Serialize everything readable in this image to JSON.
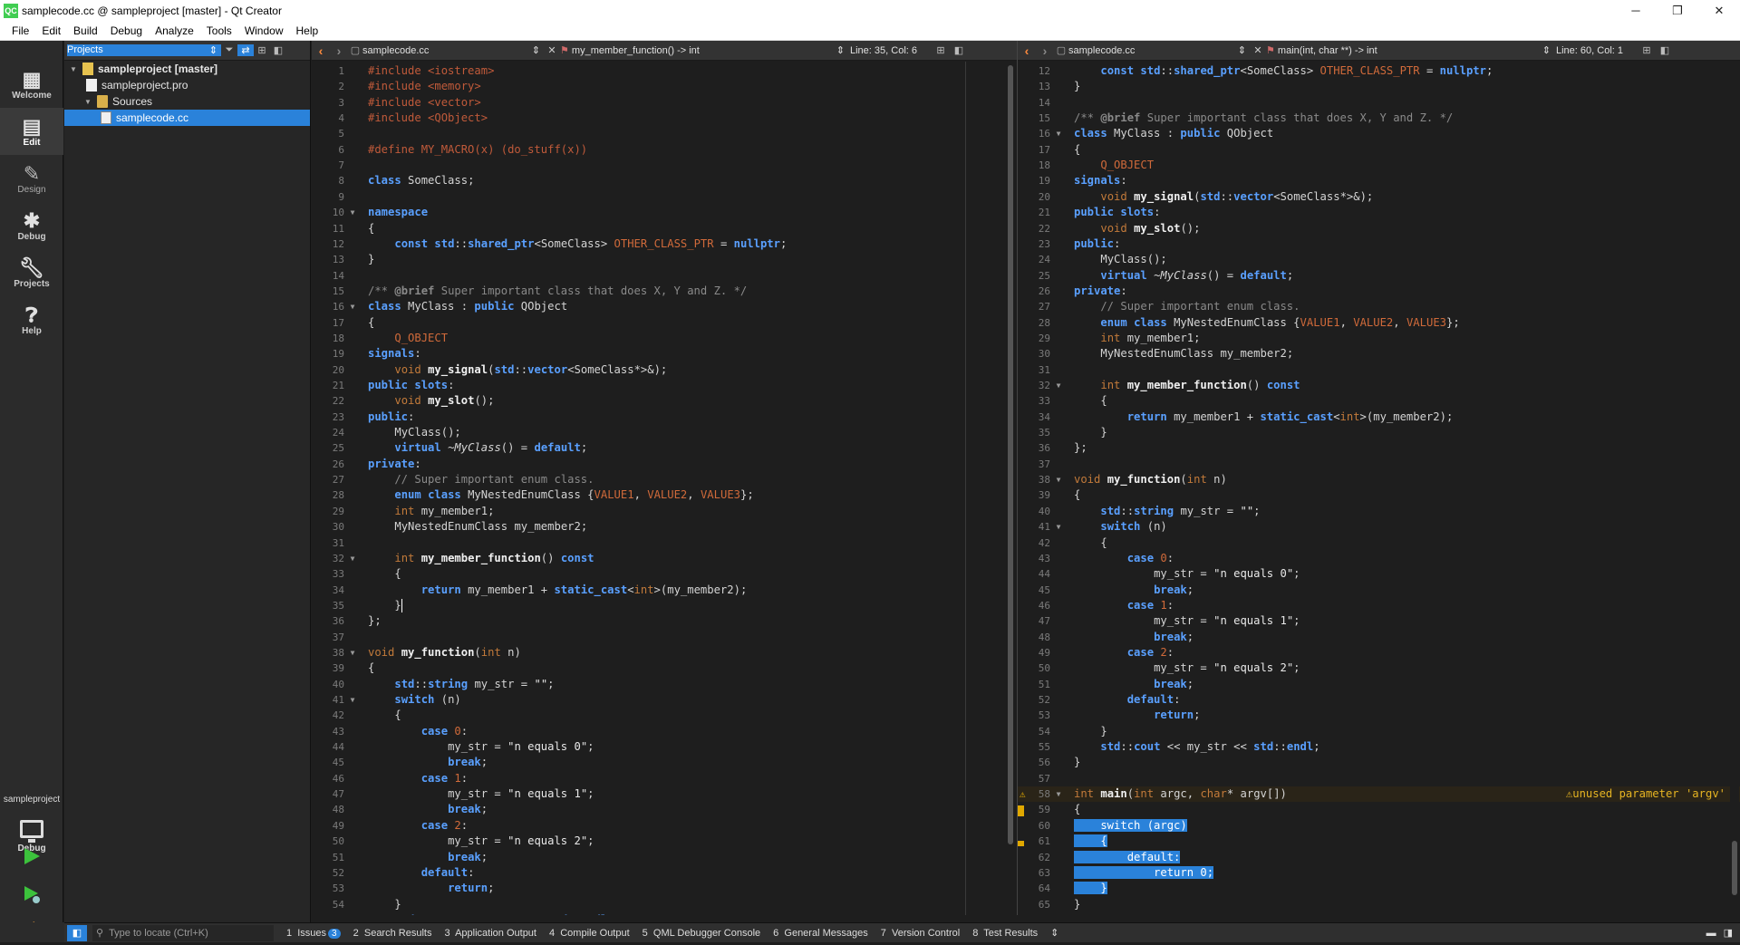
{
  "window": {
    "title": "samplecode.cc @ sampleproject [master] - Qt Creator",
    "app_icon_text": "QC",
    "minimize": "─",
    "maximize": "❐",
    "close": "✕"
  },
  "menubar": [
    "File",
    "Edit",
    "Build",
    "Debug",
    "Analyze",
    "Tools",
    "Window",
    "Help"
  ],
  "modes": [
    {
      "label": "Welcome",
      "icon": "grid-icon"
    },
    {
      "label": "Edit",
      "icon": "edit-icon",
      "active": true
    },
    {
      "label": "Design",
      "icon": "pencil-icon"
    },
    {
      "label": "Debug",
      "icon": "bug-icon"
    },
    {
      "label": "Projects",
      "icon": "wrench-icon"
    },
    {
      "label": "Help",
      "icon": "help-icon"
    }
  ],
  "kit": {
    "project": "sampleproject",
    "config": "Debug"
  },
  "projects_pane": {
    "selector": "Projects",
    "tree": [
      {
        "label": "sampleproject [master]",
        "type": "project",
        "depth": 0,
        "expanded": true
      },
      {
        "label": "sampleproject.pro",
        "type": "pro",
        "depth": 1
      },
      {
        "label": "Sources",
        "type": "folder",
        "depth": 1,
        "expanded": true
      },
      {
        "label": "samplecode.cc",
        "type": "cc",
        "depth": 2,
        "selected": true
      }
    ]
  },
  "editor_left": {
    "file": "samplecode.cc",
    "function": "my_member_function() -> int",
    "position": "Line: 35, Col: 6"
  },
  "editor_right": {
    "file": "samplecode.cc",
    "function": "main(int, char **) -> int",
    "position": "Line: 60, Col: 1",
    "warning": "unused parameter 'argv'"
  },
  "code_lines": {
    "1": "#include <iostream>",
    "2": "#include <memory>",
    "3": "#include <vector>",
    "4": "#include <QObject>",
    "5": "",
    "6": "#define MY_MACRO(x) (do_stuff(x))",
    "7": "",
    "8": "class SomeClass;",
    "9": "",
    "10": "namespace",
    "11": "{",
    "12": "    const std::shared_ptr<SomeClass> OTHER_CLASS_PTR = nullptr;",
    "13": "}",
    "14": "",
    "15": "/** @brief Super important class that does X, Y and Z. */",
    "16": "class MyClass : public QObject",
    "17": "{",
    "18": "    Q_OBJECT",
    "19": "signals:",
    "20": "    void my_signal(std::vector<SomeClass*>&);",
    "21": "public slots:",
    "22": "    void my_slot();",
    "23": "public:",
    "24": "    MyClass();",
    "25": "    virtual ~MyClass() = default;",
    "26": "private:",
    "27": "    // Super important enum class.",
    "28": "    enum class MyNestedEnumClass {VALUE1, VALUE2, VALUE3};",
    "29": "    int my_member1;",
    "30": "    MyNestedEnumClass my_member2;",
    "31": "",
    "32": "    int my_member_function() const",
    "33": "    {",
    "34": "        return my_member1 + static_cast<int>(my_member2);",
    "35": "    }",
    "36": "};",
    "37": "",
    "38": "void my_function(int n)",
    "39": "{",
    "40": "    std::string my_str = \"\";",
    "41": "    switch (n)",
    "42": "    {",
    "43": "        case 0:",
    "44": "            my_str = \"n equals 0\";",
    "45": "            break;",
    "46": "        case 1:",
    "47": "            my_str = \"n equals 1\";",
    "48": "            break;",
    "49": "        case 2:",
    "50": "            my_str = \"n equals 2\";",
    "51": "            break;",
    "52": "        default:",
    "53": "            return;",
    "54": "    }",
    "55": "    std::cout << my_str << std::endl;",
    "56": "}",
    "57": "",
    "58": "int main(int argc, char* argv[])",
    "59": "{",
    "60": "    switch (argc)",
    "61": "    {",
    "62": "        default:",
    "63": "            return 0;",
    "64": "    }",
    "65": "}",
    "66": ""
  },
  "statusbar": {
    "locator_placeholder": "Type to locate (Ctrl+K)",
    "tabs": [
      {
        "num": "1",
        "label": "Issues",
        "badge": "3"
      },
      {
        "num": "2",
        "label": "Search Results"
      },
      {
        "num": "3",
        "label": "Application Output"
      },
      {
        "num": "4",
        "label": "Compile Output"
      },
      {
        "num": "5",
        "label": "QML Debugger Console"
      },
      {
        "num": "6",
        "label": "General Messages"
      },
      {
        "num": "7",
        "label": "Version Control"
      },
      {
        "num": "8",
        "label": "Test Results"
      }
    ]
  },
  "colors": {
    "accent": "#2a82da",
    "keyword": "#5aa0ff",
    "type_keyword": "#c27a3a",
    "preprocessor": "#c05a3a",
    "comment": "#8a8a8a",
    "warning": "#e6b422"
  }
}
